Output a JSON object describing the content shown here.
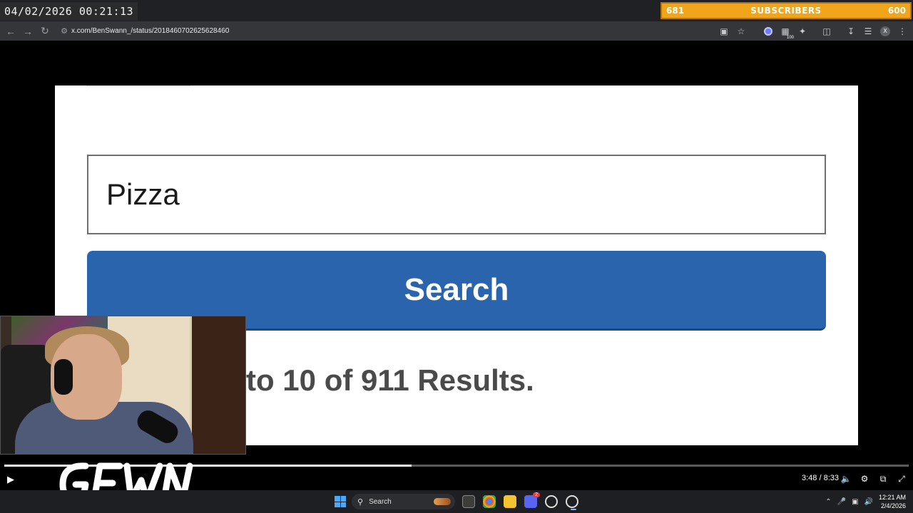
{
  "overlay": {
    "timestamp": "04/02/2026 00:21:13",
    "subs_current": "681",
    "subs_label": "SUBSCRIBERS",
    "subs_goal": "600"
  },
  "browser": {
    "url": "x.com/BenSwann_/status/2018460702625628460",
    "extension_badge": "100",
    "profile_initial": "X"
  },
  "page": {
    "search_value": "Pizza",
    "search_button_label": "Search",
    "results_text": "to 10 of 911 Results."
  },
  "player": {
    "progress_percent": 45,
    "time_readout": "3:48 / 8:33"
  },
  "taskbar": {
    "search_label": "Search",
    "discord_badge": "2",
    "time": "12:21 AM",
    "date": "2/4/2026"
  },
  "colors": {
    "search_button": "#2a64ad",
    "sub_bar": "#f1a51a"
  }
}
